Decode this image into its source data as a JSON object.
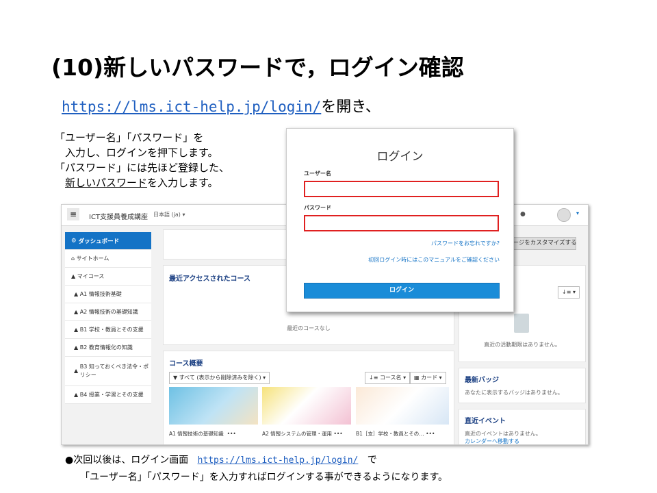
{
  "slide_title": "(10)新しいパスワードで，ログイン確認",
  "url_line": {
    "url": "https://lms.ict-help.jp/login/",
    "suffix": "を開き、"
  },
  "instructions": {
    "line1": "「ユーザー名」「パスワード」を",
    "line2": "入力し、ログインを押下します。",
    "line3": "「パスワード」には先ほど登録した、",
    "line4_underlined": "新しいパスワード",
    "line4_rest": "を入力します。"
  },
  "lms": {
    "menu_icon": "hamburger-icon",
    "site_name": "ICT支援員養成講座",
    "language": "日本語 (ja) ▾",
    "sidebar": [
      {
        "label": "ダッシュボード",
        "icon": "dashboard-icon"
      },
      {
        "label": "サイトホーム",
        "icon": "home-icon"
      },
      {
        "label": "マイコース",
        "icon": "graduation-cap-icon"
      },
      {
        "label": "A1 情報技術基礎",
        "icon": "graduation-cap-icon"
      },
      {
        "label": "A2 情報技術の基礎知識",
        "icon": "graduation-cap-icon"
      },
      {
        "label": "B1 学校・教員とその支援",
        "icon": "graduation-cap-icon"
      },
      {
        "label": "B2 教育情報化の知識",
        "icon": "graduation-cap-icon"
      },
      {
        "label": "B3 知っておくべき法令・ポリシー",
        "icon": "graduation-cap-icon"
      },
      {
        "label": "B4 授業・学習とその支援",
        "icon": "graduation-cap-icon"
      }
    ],
    "customize_button": "ページをカスタマイズする",
    "recent_courses": {
      "title": "最近アクセスされたコース",
      "empty": "最近のコースなし"
    },
    "timeline": {
      "sort_icon": "↓≡ ▾",
      "empty": "直近の活動期限はありません。"
    },
    "course_overview": {
      "title": "コース概要",
      "filter": "▼ すべて (表示から削除済みを除く) ▾",
      "sort": "↓≡ コース名 ▾",
      "view": "▦ カード ▾",
      "cards": [
        "A1 情報技術の基礎知識",
        "A2 情報システムの管理・運用",
        "B1［支］学校・教員とその…"
      ],
      "card_menu": "•••"
    },
    "badges": {
      "title": "最新バッジ",
      "empty": "あなたに表示するバッジはありません。"
    },
    "events": {
      "title": "直近イベント",
      "empty": "直近のイベントはありません。",
      "link": "カレンダーへ移動する"
    }
  },
  "login": {
    "title": "ログイン",
    "username_label": "ユーザー名",
    "username_value": "",
    "password_label": "パスワード",
    "password_value": "",
    "forgot_link": "パスワードをお忘れですか?",
    "first_login_link": "初回ログイン時にはこのマニュアルをご確認ください",
    "button": "ログイン"
  },
  "footer": {
    "line1_prefix": "●次回以後は、ログイン画面",
    "line1_url": "https://lms.ict-help.jp/login/",
    "line1_suffix": "で",
    "line2": "「ユーザー名」「パスワード」を入力すればログインする事ができるようになります。"
  }
}
